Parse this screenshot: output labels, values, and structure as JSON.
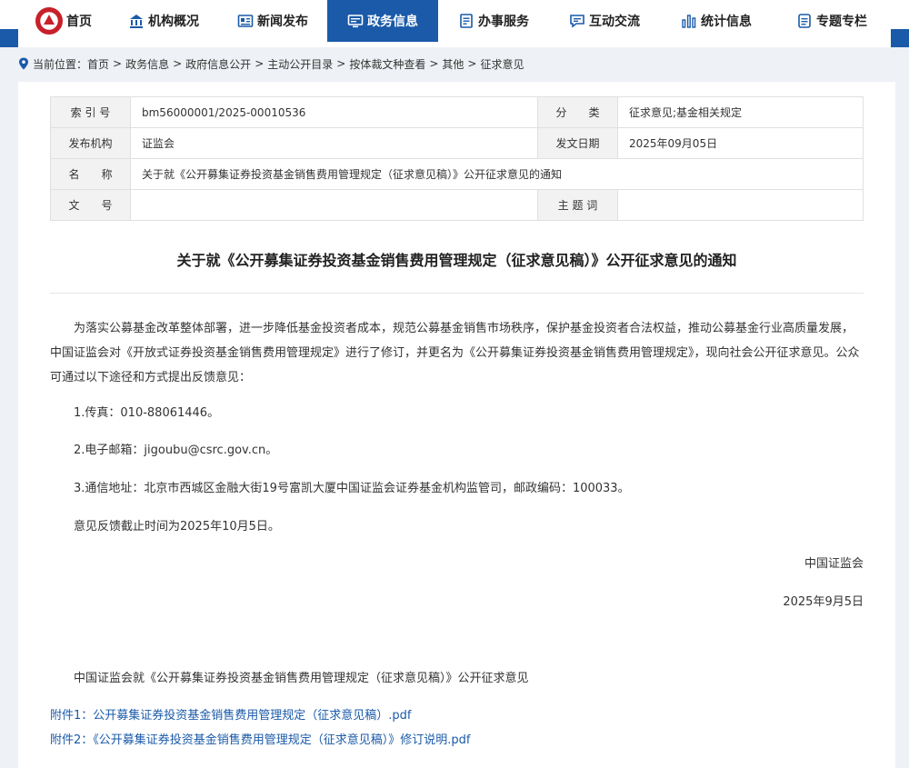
{
  "nav": {
    "items": [
      {
        "label": "首页",
        "icon": "logo-emblem"
      },
      {
        "label": "机构概况",
        "icon": "building-icon"
      },
      {
        "label": "新闻发布",
        "icon": "newspaper-icon"
      },
      {
        "label": "政务信息",
        "icon": "monitor-icon",
        "active": true
      },
      {
        "label": "办事服务",
        "icon": "clipboard-icon"
      },
      {
        "label": "互动交流",
        "icon": "chat-icon"
      },
      {
        "label": "统计信息",
        "icon": "bar-chart-icon"
      },
      {
        "label": "专题专栏",
        "icon": "document-icon"
      }
    ]
  },
  "breadcrumb": {
    "prefix": "当前位置：",
    "items": [
      "首页",
      "政务信息",
      "政府信息公开",
      "主动公开目录",
      "按体裁文种查看",
      "其他",
      "征求意见"
    ],
    "separator": ">"
  },
  "meta": {
    "index_label": "索 引 号",
    "index_value": "bm56000001/2025-00010536",
    "category_label": "分　　类",
    "category_value": "征求意见;基金相关规定",
    "publisher_label": "发布机构",
    "publisher_value": "证监会",
    "date_label": "发文日期",
    "date_value": "2025年09月05日",
    "name_label": "名　　称",
    "name_value": "关于就《公开募集证券投资基金销售费用管理规定（征求意见稿）》公开征求意见的通知",
    "docno_label": "文　　号",
    "docno_value": "",
    "keywords_label": "主 题 词",
    "keywords_value": ""
  },
  "article": {
    "title": "关于就《公开募集证券投资基金销售费用管理规定（征求意见稿）》公开征求意见的通知",
    "intro": "为落实公募基金改革整体部署，进一步降低基金投资者成本，规范公募基金销售市场秩序，保护基金投资者合法权益，推动公募基金行业高质量发展，中国证监会对《开放式证券投资基金销售费用管理规定》进行了修订，并更名为《公开募集证券投资基金销售费用管理规定》，现向社会公开征求意见。公众可通过以下途径和方式提出反馈意见：",
    "item1": "1.传真：010-88061446。",
    "item2": "2.电子邮箱：jigoubu@csrc.gov.cn。",
    "item3": "3.通信地址：北京市西城区金融大街19号富凯大厦中国证监会证券基金机构监管司，邮政编码：100033。",
    "deadline": "意见反馈截止时间为2025年10月5日。",
    "signature": "中国证监会",
    "sign_date": "2025年9月5日",
    "note": "中国证监会就《公开募集证券投资基金销售费用管理规定（征求意见稿）》公开征求意见"
  },
  "attachments": [
    "附件1：公开募集证券投资基金销售费用管理规定（征求意见稿）.pdf",
    "附件2：《公开募集证券投资基金销售费用管理规定（征求意见稿）》修订说明.pdf"
  ],
  "colors": {
    "accent": "#1a5aa9",
    "emblem": "#c8202a"
  }
}
